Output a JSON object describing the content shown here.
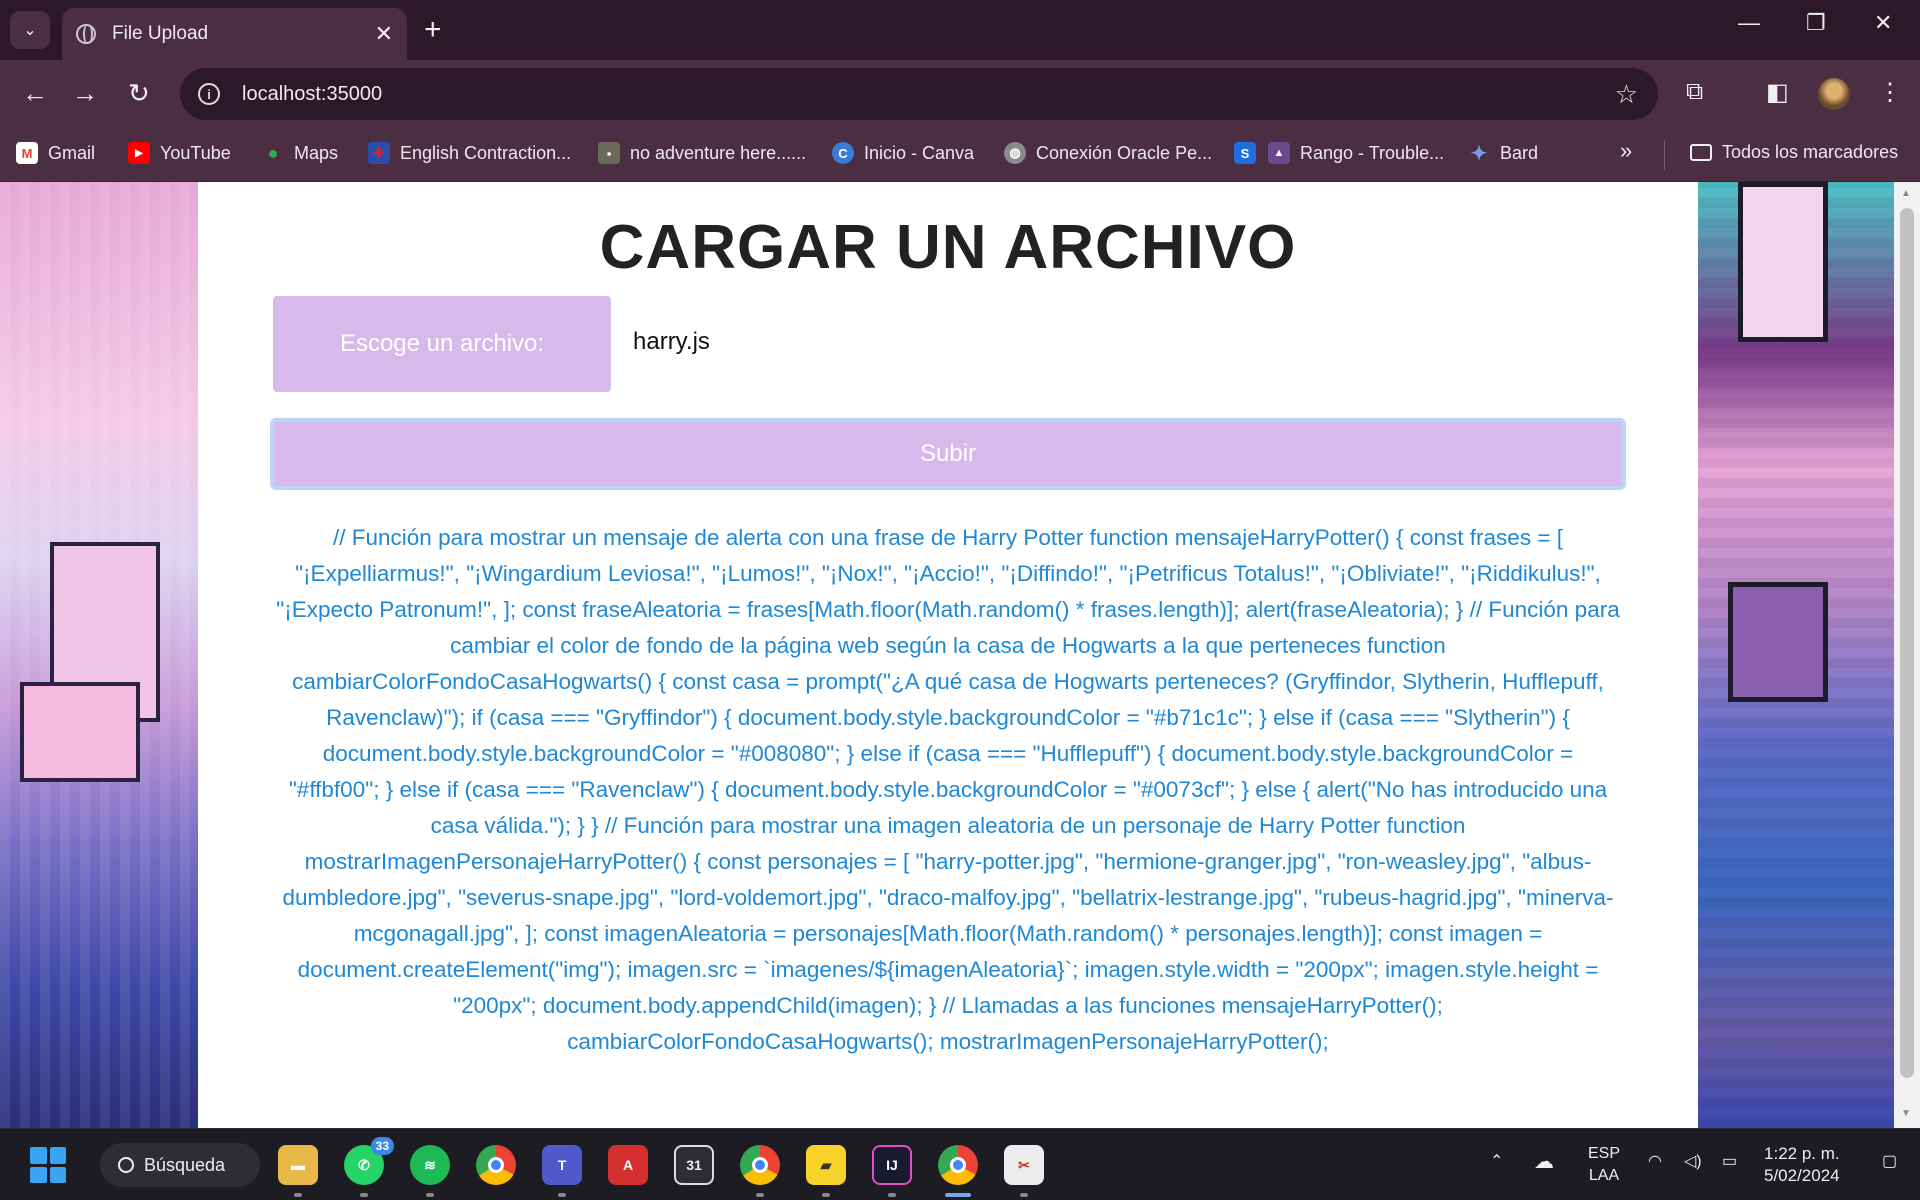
{
  "browser": {
    "tab_title": "File Upload",
    "new_tab": "+",
    "url": "localhost:35000",
    "bookmarks": [
      {
        "label": "Gmail",
        "icon": "gmail-icon",
        "color": "#ea4335",
        "glyph": "M"
      },
      {
        "label": "YouTube",
        "icon": "youtube-icon",
        "color": "#ff0000",
        "glyph": "▶"
      },
      {
        "label": "Maps",
        "icon": "maps-icon",
        "color": "#34a853",
        "glyph": "●"
      },
      {
        "label": "English Contraction...",
        "icon": "uk-flag-icon",
        "color": "#2a4ea8",
        "glyph": "+"
      },
      {
        "label": "no adventure here......",
        "icon": "image-thumb-icon",
        "color": "#6a6a5a",
        "glyph": "▪"
      },
      {
        "label": "Inicio - Canva",
        "icon": "canva-icon",
        "color": "#3a7bd5",
        "glyph": "C"
      },
      {
        "label": "Conexión Oracle Pe...",
        "icon": "globe-icon",
        "color": "#8a8a8a",
        "glyph": "◍"
      },
      {
        "label": "",
        "icon": "s-app-icon",
        "color": "#1f6fe0",
        "glyph": "S"
      },
      {
        "label": "Rango - Trouble...",
        "icon": "game-icon",
        "color": "#6a4a8a",
        "glyph": "▲"
      },
      {
        "label": "Bard",
        "icon": "bard-icon",
        "color": "#5a7af0",
        "glyph": "✦"
      }
    ],
    "bookmarks_more": "»",
    "all_bookmarks": "Todos los marcadores"
  },
  "page": {
    "title": "CARGAR UN ARCHIVO",
    "choose_label": "Escoge un archivo:",
    "file_name": "harry.js",
    "upload_button": "Subir",
    "file_content": "// Función para mostrar un mensaje de alerta con una frase de Harry Potter function mensajeHarryPotter() { const frases = [ \"¡Expelliarmus!\", \"¡Wingardium Leviosa!\", \"¡Lumos!\", \"¡Nox!\", \"¡Accio!\", \"¡Diffindo!\", \"¡Petrificus Totalus!\", \"¡Obliviate!\", \"¡Riddikulus!\", \"¡Expecto Patronum!\", ]; const fraseAleatoria = frases[Math.floor(Math.random() * frases.length)]; alert(fraseAleatoria); } // Función para cambiar el color de fondo de la página web según la casa de Hogwarts a la que perteneces function cambiarColorFondoCasaHogwarts() { const casa = prompt(\"¿A qué casa de Hogwarts perteneces? (Gryffindor, Slytherin, Hufflepuff, Ravenclaw)\"); if (casa === \"Gryffindor\") { document.body.style.backgroundColor = \"#b71c1c\"; } else if (casa === \"Slytherin\") { document.body.style.backgroundColor = \"#008080\"; } else if (casa === \"Hufflepuff\") { document.body.style.backgroundColor = \"#ffbf00\"; } else if (casa === \"Ravenclaw\") { document.body.style.backgroundColor = \"#0073cf\"; } else { alert(\"No has introducido una casa válida.\"); } } // Función para mostrar una imagen aleatoria de un personaje de Harry Potter function mostrarImagenPersonajeHarryPotter() { const personajes = [ \"harry-potter.jpg\", \"hermione-granger.jpg\", \"ron-weasley.jpg\", \"albus-dumbledore.jpg\", \"severus-snape.jpg\", \"lord-voldemort.jpg\", \"draco-malfoy.jpg\", \"bellatrix-lestrange.jpg\", \"rubeus-hagrid.jpg\", \"minerva-mcgonagall.jpg\", ]; const imagenAleatoria = personajes[Math.floor(Math.random() * personajes.length)]; const imagen = document.createElement(\"img\"); imagen.src = `imagenes/${imagenAleatoria}`; imagen.style.width = \"200px\"; imagen.style.height = \"200px\"; document.body.appendChild(imagen); } // Llamadas a las funciones mensajeHarryPotter(); cambiarColorFondoCasaHogwarts(); mostrarImagenPersonajeHarryPotter();"
  },
  "taskbar": {
    "search_label": "Búsqueda",
    "whatsapp_badge": "33",
    "calendar_day": "31",
    "lang_top": "ESP",
    "lang_bottom": "LAA",
    "time": "1:22 p. m.",
    "date": "5/02/2024"
  },
  "colors": {
    "accent_purple": "#d8b9ec",
    "code_blue": "#1e88d6",
    "chrome_dark": "#2c1826",
    "chrome_mid": "#4b2e42"
  }
}
